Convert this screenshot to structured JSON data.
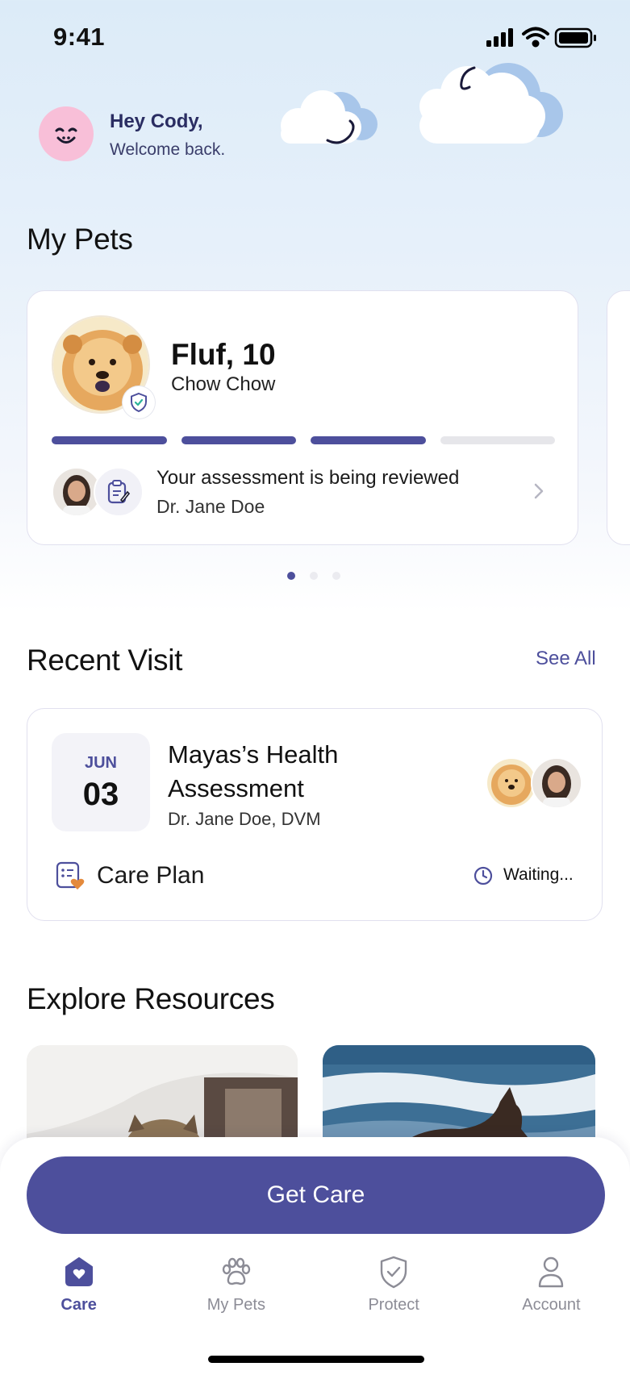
{
  "status_bar": {
    "time": "9:41"
  },
  "greeting": {
    "title": "Hey Cody,",
    "subtitle": "Welcome back."
  },
  "my_pets": {
    "title": "My Pets",
    "pet": {
      "name": "Fluf, 10",
      "breed": "Chow Chow",
      "progress_steps_total": 4,
      "progress_steps_done": 3
    },
    "assessment": {
      "status": "Your assessment is being reviewed",
      "doctor": "Dr. Jane Doe"
    },
    "carousel": {
      "pages": 3,
      "current": 1
    }
  },
  "recent_visit": {
    "title": "Recent Visit",
    "see_all": "See All",
    "visit": {
      "month": "JUN",
      "day": "03",
      "title": "Mayas’s Health Assessment",
      "doctor": "Dr. Jane Doe, DVM",
      "care_plan_label": "Care Plan",
      "status": "Waiting..."
    }
  },
  "explore": {
    "title": "Explore Resources"
  },
  "cta": {
    "label": "Get Care"
  },
  "tab_bar": {
    "items": [
      {
        "label": "Care",
        "icon": "home-heart-icon",
        "active": true
      },
      {
        "label": "My Pets",
        "icon": "paw-icon",
        "active": false
      },
      {
        "label": "Protect",
        "icon": "shield-check-icon",
        "active": false
      },
      {
        "label": "Account",
        "icon": "person-icon",
        "active": false
      }
    ]
  },
  "colors": {
    "accent": "#4d4f9c",
    "avatar_pink": "#f8bfd8",
    "background_top": "#dcebf8"
  }
}
